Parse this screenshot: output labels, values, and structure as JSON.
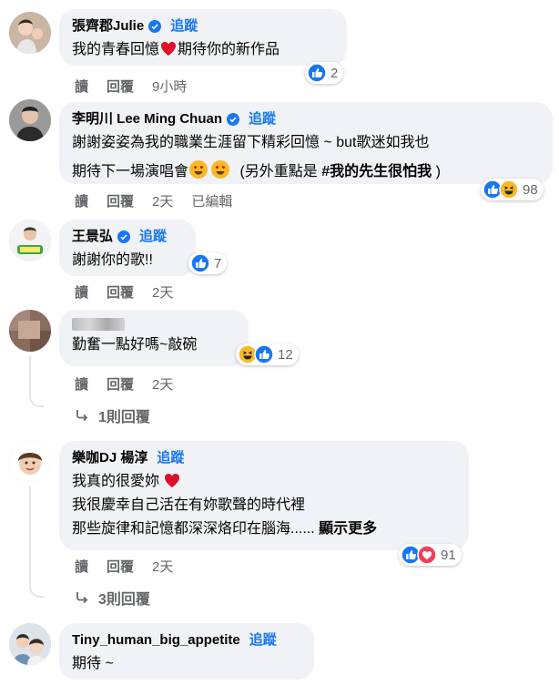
{
  "follow_label": "追蹤",
  "actions": {
    "read": "讀",
    "reply": "回覆"
  },
  "comments": [
    {
      "name": "張齊郡Julie",
      "verified": true,
      "text_before": "我的青春回憶",
      "text_after": "期待你的新作品",
      "time": "9小時",
      "reaction_count": "2"
    },
    {
      "name": "李明川 Lee Ming Chuan",
      "verified": true,
      "line1": "謝謝姿姿為我的職業生涯留下精彩回憶 ~ but歌迷如我也",
      "line2_before": "期待下一場演唱會",
      "line2_mid": "(另外重點是",
      "hashtag": "#我的先生很怕我",
      "line2_end": ")",
      "time": "2天",
      "edited": "已編輯",
      "reaction_count": "98"
    },
    {
      "name": "王景弘",
      "verified": true,
      "text": "謝謝你的歌!!",
      "time": "2天",
      "reaction_count": "7"
    },
    {
      "text": "勤奮一點好嗎~敲碗",
      "time": "2天",
      "reaction_count": "12",
      "replies_label": "1則回覆"
    },
    {
      "name": "樂咖DJ 楊淳",
      "verified": false,
      "line1": "我真的很愛妳",
      "line2": "我很慶幸自己活在有妳歌聲的時代裡",
      "line3": "那些旋律和記憶都深深烙印在腦海......",
      "see_more": "顯示更多",
      "time": "2天",
      "reaction_count": "91",
      "replies_label": "3則回覆"
    },
    {
      "name": "Tiny_human_big_appetite",
      "verified": false,
      "text": "期待 ~"
    }
  ],
  "colors": {
    "link": "#1877f2",
    "bubble": "#f0f2f5",
    "muted": "#65676b"
  }
}
